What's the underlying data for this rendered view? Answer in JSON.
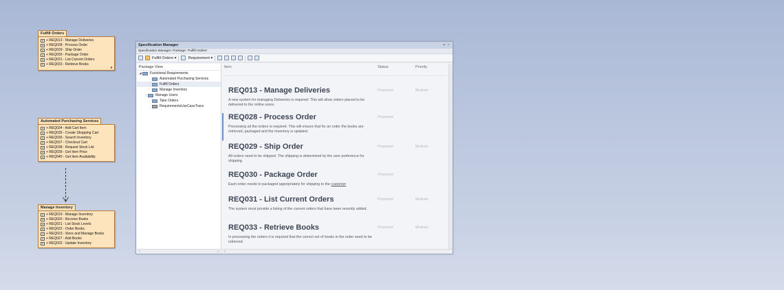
{
  "packages": [
    {
      "title": "Fulfill Orders",
      "items": [
        "+ REQ013 - Manage Deliveries",
        "+ REQ028 - Process Order",
        "+ REQ029 - Ship Order",
        "+ REQ030 - Package Order",
        "+ REQ031 - List Current Orders",
        "+ REQ033 - Retrieve Books"
      ]
    },
    {
      "title": "Automated Purchasing Services",
      "items": [
        "+ REQ034 - Add Cart Item",
        "+ REQ035 - Create Shopping Cart",
        "+ REQ036 - Search Inventory",
        "+ REQ037 - Checkout Cart",
        "+ REQ038 - Request Stock List",
        "+ REQ039 - Get Item Price",
        "+ REQ040 - Get Item Availability"
      ]
    },
    {
      "title": "Manage Inventory",
      "items": [
        "+ REQ019 - Manage Inventory",
        "+ REQ020 - Receive Books",
        "+ REQ021 - List Stock Levels",
        "+ REQ022 - Order Books",
        "+ REQ023 - Store and Manage Books",
        "+ REQ027 - Add Books",
        "+ REQ032 - Update Inventory"
      ]
    }
  ],
  "spec_manager": {
    "title": "Specification Manager",
    "window_controls": "▾ ×",
    "subtitle": "Specification Manager:  Package: 'Fulfill Orders'",
    "toolbar": {
      "package_label": "Fulfill Orders",
      "type_label": "Requirement",
      "dropdown_glyph": "▾"
    },
    "package_view": {
      "header": "Package View",
      "tree": [
        {
          "label": "Functional Requirements",
          "toggle": "◢",
          "icon": "folder"
        },
        {
          "label": "Automated Purchasing Services",
          "toggle": "",
          "icon": "folder"
        },
        {
          "label": "Fulfill Orders",
          "toggle": "",
          "icon": "folder",
          "selected": true
        },
        {
          "label": "Manage Inventory",
          "toggle": "",
          "icon": "folder"
        },
        {
          "label": "Manage Users",
          "toggle": "›",
          "icon": "folder"
        },
        {
          "label": "Take Orders",
          "toggle": "",
          "icon": "folder"
        },
        {
          "label": "RequirementsUseCaseTrace",
          "toggle": "",
          "icon": "diagram"
        }
      ],
      "scroll_left": "‹",
      "scroll_right": "›"
    },
    "columns": {
      "item": "Item",
      "status": "Status",
      "priority": "Priority"
    },
    "records": [
      {
        "title": "REQ013 - Manage Deliveries",
        "desc": "A new system for managing Deliveries is required. This will allow orders placed to be delivered to the online users.",
        "status": "Proposed",
        "priority": "Medium"
      },
      {
        "title": "REQ028 - Process Order",
        "desc": "Processing all the orders is required. This will ensure that for an order the books are retrieved, packaged and the Inventory is updated.",
        "status": "Proposed",
        "priority": ""
      },
      {
        "title": "REQ029 - Ship Order",
        "desc": "All orders need to be shipped.  The shipping is determined by the user preference for shipping.",
        "status": "Proposed",
        "priority": "Medium"
      },
      {
        "title": "REQ030 - Package Order",
        "desc": "Each order needs to packaged appropriately for shipping to the ",
        "desc_link": "customer",
        "status": "Proposed",
        "priority": ""
      },
      {
        "title": "REQ031 - List Current Orders",
        "desc": "The system must provide a listing of the current orders that have been recently added.",
        "status": "Proposed",
        "priority": "Medium"
      },
      {
        "title": "REQ033 - Retrieve Books",
        "desc": "In processing the orders it is required that the correct set of books in the order need to be retrieved.",
        "status": "Proposed",
        "priority": "Medium"
      }
    ]
  }
}
